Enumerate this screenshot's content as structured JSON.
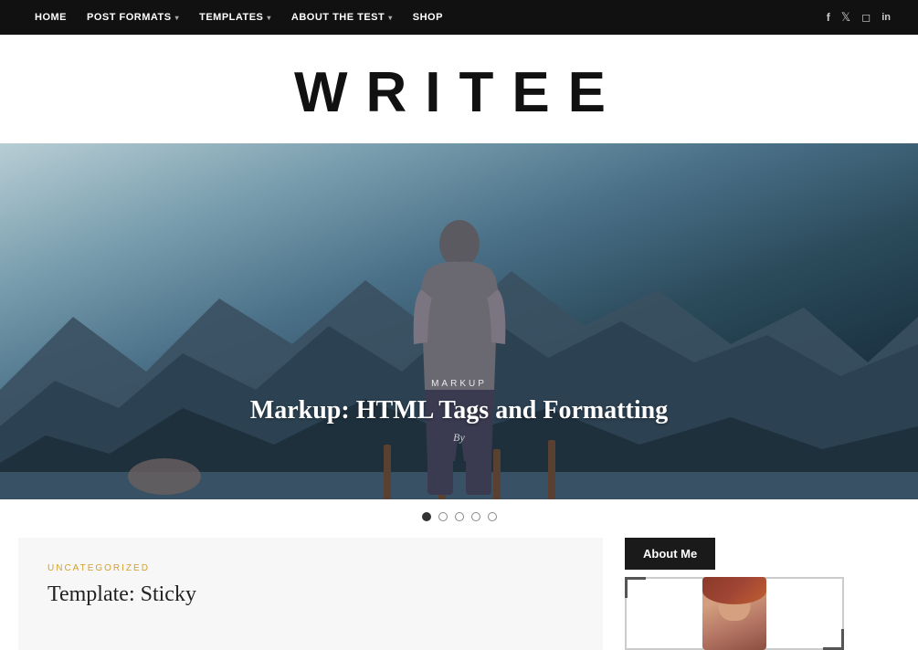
{
  "nav": {
    "links": [
      {
        "label": "HOME",
        "hasChevron": false
      },
      {
        "label": "POST FORMATS",
        "hasChevron": true
      },
      {
        "label": "TEMPLATES",
        "hasChevron": true
      },
      {
        "label": "ABOUT THE TEST",
        "hasChevron": true
      },
      {
        "label": "SHOP",
        "hasChevron": false
      }
    ],
    "social": [
      {
        "name": "facebook-icon",
        "glyph": "f"
      },
      {
        "name": "twitter-icon",
        "glyph": "t"
      },
      {
        "name": "instagram-icon",
        "glyph": "📷"
      },
      {
        "name": "linkedin-icon",
        "glyph": "in"
      }
    ]
  },
  "site": {
    "title": "WRITEE"
  },
  "hero": {
    "category": "MARKUP",
    "title": "Markup: HTML Tags and Formatting",
    "by_label": "By"
  },
  "slider": {
    "dots": [
      {
        "active": true
      },
      {
        "active": false
      },
      {
        "active": false
      },
      {
        "active": false
      },
      {
        "active": false
      }
    ]
  },
  "article": {
    "category": "UNCATEGORIZED",
    "title": "Template: Sticky"
  },
  "sidebar": {
    "about_me_label": "About Me"
  }
}
